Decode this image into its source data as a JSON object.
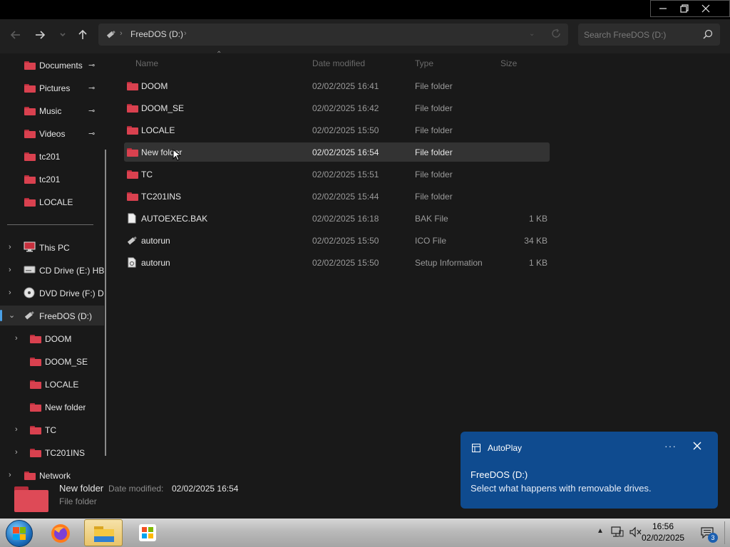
{
  "window": {
    "controls": [
      "minimize",
      "restore",
      "close"
    ]
  },
  "toolbar": {
    "breadcrumb": "FreeDOS (D:)",
    "search_placeholder": "Search FreeDOS (D:)"
  },
  "sidebar": {
    "quick_access": [
      {
        "label": "Documents",
        "icon": "documents-folder-icon",
        "pinned": true
      },
      {
        "label": "Pictures",
        "icon": "pictures-folder-icon",
        "pinned": true
      },
      {
        "label": "Music",
        "icon": "music-folder-icon",
        "pinned": true
      },
      {
        "label": "Videos",
        "icon": "videos-folder-icon",
        "pinned": true
      },
      {
        "label": "tc201",
        "icon": "folder-icon",
        "pinned": false
      },
      {
        "label": "tc201",
        "icon": "folder-icon",
        "pinned": false
      },
      {
        "label": "LOCALE",
        "icon": "folder-icon",
        "pinned": false
      }
    ],
    "drives": [
      {
        "label": "This PC",
        "icon": "computer-icon"
      },
      {
        "label": "CD Drive (E:) HB",
        "icon": "cd-drive-icon"
      },
      {
        "label": "DVD Drive (F:) D",
        "icon": "dvd-drive-icon"
      },
      {
        "label": "FreeDOS (D:)",
        "icon": "usb-drive-icon",
        "selected": true,
        "expanded": true
      }
    ],
    "subfolders": [
      {
        "label": "DOOM",
        "expandable": true
      },
      {
        "label": "DOOM_SE",
        "expandable": false
      },
      {
        "label": "LOCALE",
        "expandable": false
      },
      {
        "label": "New folder",
        "expandable": false
      },
      {
        "label": "TC",
        "expandable": true
      },
      {
        "label": "TC201INS",
        "expandable": true
      }
    ],
    "network": "Network"
  },
  "columns": {
    "name": "Name",
    "date": "Date modified",
    "type": "Type",
    "size": "Size"
  },
  "files": [
    {
      "name": "DOOM",
      "date": "02/02/2025 16:41",
      "type": "File folder",
      "size": "",
      "icon": "folder-icon"
    },
    {
      "name": "DOOM_SE",
      "date": "02/02/2025 16:42",
      "type": "File folder",
      "size": "",
      "icon": "folder-icon"
    },
    {
      "name": "LOCALE",
      "date": "02/02/2025 15:50",
      "type": "File folder",
      "size": "",
      "icon": "folder-icon"
    },
    {
      "name": "New folder",
      "date": "02/02/2025 16:54",
      "type": "File folder",
      "size": "",
      "icon": "folder-icon",
      "hover": true
    },
    {
      "name": "TC",
      "date": "02/02/2025 15:51",
      "type": "File folder",
      "size": "",
      "icon": "folder-icon"
    },
    {
      "name": "TC201INS",
      "date": "02/02/2025 15:44",
      "type": "File folder",
      "size": "",
      "icon": "folder-icon"
    },
    {
      "name": "AUTOEXEC.BAK",
      "date": "02/02/2025 16:18",
      "type": "BAK File",
      "size": "1 KB",
      "icon": "file-icon"
    },
    {
      "name": "autorun",
      "date": "02/02/2025 15:50",
      "type": "ICO File",
      "size": "34 KB",
      "icon": "usb-drive-icon"
    },
    {
      "name": "autorun",
      "date": "02/02/2025 15:50",
      "type": "Setup Information",
      "size": "1 KB",
      "icon": "settings-file-icon"
    }
  ],
  "details": {
    "name": "New folder",
    "date_label": "Date modified:",
    "date_value": "02/02/2025 16:54",
    "type": "File folder"
  },
  "toast": {
    "app": "AutoPlay",
    "title": "FreeDOS (D:)",
    "message": "Select what happens with removable drives.",
    "more": "···"
  },
  "taskbar": {
    "time": "16:56",
    "date": "02/02/2025",
    "notification_count": "3"
  },
  "colors": {
    "background": "#191919",
    "folder": "#d9414f",
    "toast": "#0f4b8f",
    "selection_accent": "#4aa0e6"
  }
}
